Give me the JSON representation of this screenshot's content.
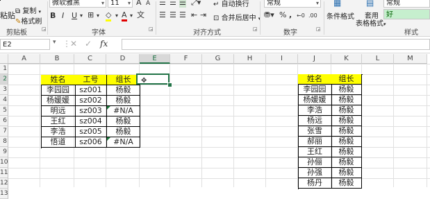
{
  "ribbon": {
    "clipboard": {
      "paste": "粘贴",
      "copy": "复制",
      "format_painter": "格式刷",
      "group": "剪贴板"
    },
    "font": {
      "name": "微软雅黑",
      "size": "11",
      "grow": "A",
      "shrink": "A",
      "bold": "B",
      "italic": "I",
      "underline": "U",
      "group": "字体"
    },
    "alignment": {
      "wrap": "自动换行",
      "merge": "合并后居中",
      "group": "对齐方式"
    },
    "number": {
      "format": "常规",
      "percent": "%",
      "comma": ",",
      "group": "数字"
    },
    "styles": {
      "conditional": "条件格式",
      "table_format_1": "套用",
      "table_format_2": "表格格式",
      "normal": "常规",
      "good": "好",
      "group": "样式"
    }
  },
  "formula_bar": {
    "name_box": "E2",
    "fx": "fx",
    "value": ""
  },
  "columns": [
    "A",
    "B",
    "C",
    "D",
    "E",
    "F",
    "G",
    "H",
    "I",
    "J",
    "K",
    "L",
    "M"
  ],
  "rows": [
    "1",
    "2",
    "3",
    "4",
    "5",
    "6",
    "7",
    "8",
    "9",
    "10",
    "11",
    "12",
    "13"
  ],
  "table1": {
    "headers": [
      "姓名",
      "工号",
      "组长"
    ],
    "rows": [
      [
        "李园园",
        "sz001",
        "杨毅"
      ],
      [
        "杨媛媛",
        "sz002",
        "杨毅"
      ],
      [
        "明远",
        "sz003",
        "#N/A"
      ],
      [
        "王红",
        "sz004",
        "杨毅"
      ],
      [
        "李浩",
        "sz005",
        "杨毅"
      ],
      [
        "悟道",
        "sz006",
        "#N/A"
      ]
    ]
  },
  "table2": {
    "headers": [
      "姓名",
      "组长"
    ],
    "rows": [
      [
        "李园园",
        "杨毅"
      ],
      [
        "杨媛媛",
        "杨毅"
      ],
      [
        "李浩",
        "杨毅"
      ],
      [
        "杨远",
        "杨毅"
      ],
      [
        "张雪",
        "杨毅"
      ],
      [
        "郝丽",
        "杨毅"
      ],
      [
        "王红",
        "杨毅"
      ],
      [
        "孙俪",
        "杨毅"
      ],
      [
        "孙强",
        "杨毅"
      ],
      [
        "杨丹",
        "杨毅"
      ]
    ]
  },
  "colors": {
    "header_fill": "#ffff00",
    "selection": "#217346",
    "error_flag": "#1a7a3a"
  }
}
